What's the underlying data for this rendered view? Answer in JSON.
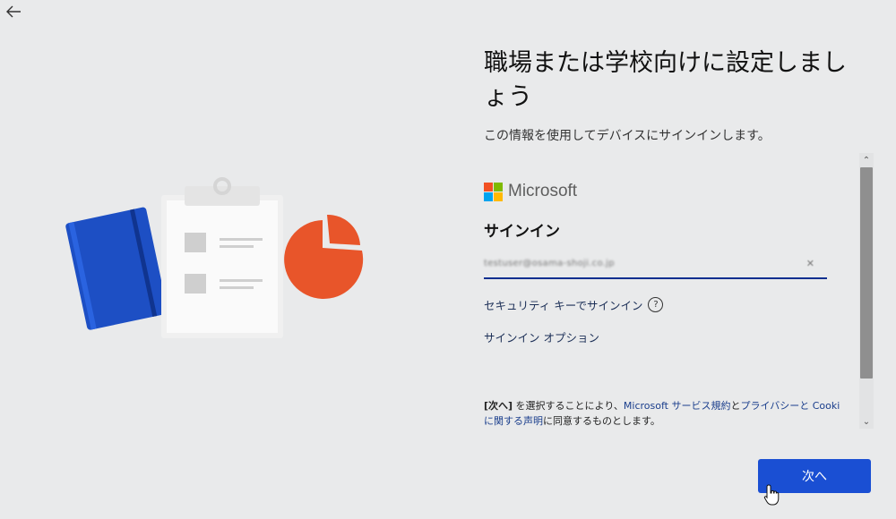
{
  "nav": {
    "back_icon": "arrow-left-icon"
  },
  "heading": {
    "title_line1": "職場または学校向けに設定しまし",
    "title_line2": "ょう",
    "subtitle": "この情報を使用してデバイスにサインインします。"
  },
  "brand": {
    "name": "Microsoft",
    "colors": [
      "#f25022",
      "#7fba00",
      "#00a4ef",
      "#ffb900"
    ]
  },
  "signin": {
    "heading": "サインイン",
    "email_value": "testuser@osama-shoji.co.jp",
    "clear_icon": "clear-x-icon",
    "security_key_link": "セキュリティ キーでサインイン",
    "help_icon_glyph": "?",
    "options_link": "サインイン オプション"
  },
  "legal": {
    "bold_next": "[次へ]",
    "text1": " を選択することにより、",
    "link_terms": "Microsoft サービス規約",
    "text2": "と",
    "link_privacy": "プライバシーと Cooki",
    "link_privacy_cont": "に関する声明",
    "text3": "に同意するものとします。"
  },
  "scrollbar": {
    "up": "⌃",
    "down": "⌄"
  },
  "next_button": "次へ",
  "colors": {
    "accent": "#1a4fd3",
    "underline": "#0a2f8f",
    "notebook": "#1d4fc4",
    "pie": "#e8552a",
    "background": "#e9eaeb"
  }
}
